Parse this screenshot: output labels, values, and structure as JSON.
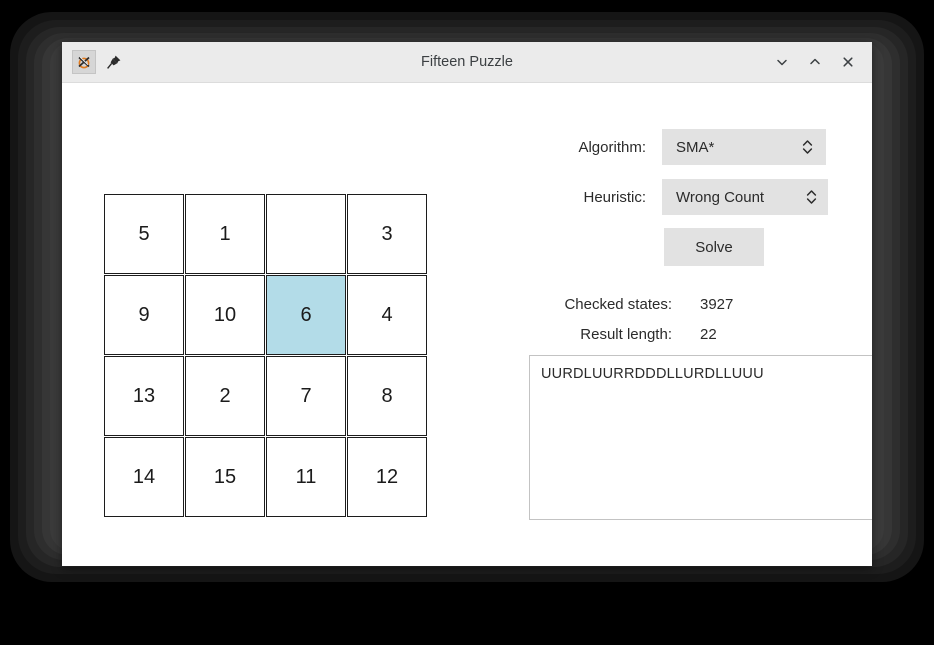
{
  "window": {
    "title": "Fifteen Puzzle",
    "app_icon": "xorg-app-icon",
    "pin_icon": "pushpin-icon",
    "controls": {
      "minimize": "chevron-down-icon",
      "maximize": "chevron-up-icon",
      "close": "close-icon"
    }
  },
  "puzzle": {
    "tiles": [
      "5",
      "1",
      "",
      "3",
      "9",
      "10",
      "6",
      "4",
      "13",
      "2",
      "7",
      "8",
      "14",
      "15",
      "11",
      "12"
    ],
    "blank_index": 2,
    "highlight_index": 6,
    "highlight_color": "#b3dce8"
  },
  "controls": {
    "algorithm_label": "Algorithm:",
    "algorithm_value": "SMA*",
    "heuristic_label": "Heuristic:",
    "heuristic_value": "Wrong Count",
    "solve_label": "Solve"
  },
  "stats": {
    "checked_states_label": "Checked states:",
    "checked_states_value": "3927",
    "result_length_label": "Result length:",
    "result_length_value": "22"
  },
  "result": {
    "text": "UURDLUURRDDDLLURDLLUUU"
  }
}
